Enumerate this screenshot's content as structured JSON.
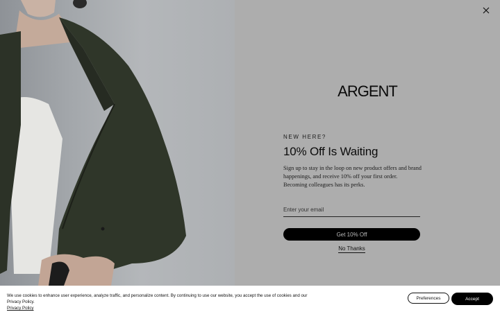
{
  "popup": {
    "brand": "ARGENT",
    "eyebrow": "NEW HERE?",
    "heading": "10% Off Is Waiting",
    "body": "Sign up to stay in the loop on new product offers and brand happenings, and receive 10% off your first order. Becoming colleagues has its perks.",
    "email_placeholder": "Enter your email",
    "cta_label": "Get 10% Off",
    "dismiss_label": "No Thanks",
    "close_icon": "close-icon"
  },
  "cookie_banner": {
    "text": "We use cookies to enhance user experience, analyze traffic, and personalize content. By continuing to use our website, you accept the use of cookies and our Privacy Policy.",
    "link_label": "Privacy Policy",
    "preferences_label": "Preferences",
    "accept_label": "Accept"
  },
  "colors": {
    "panel_bg": "#adadad",
    "button_bg": "#000000",
    "banner_bg": "#ffffff"
  }
}
